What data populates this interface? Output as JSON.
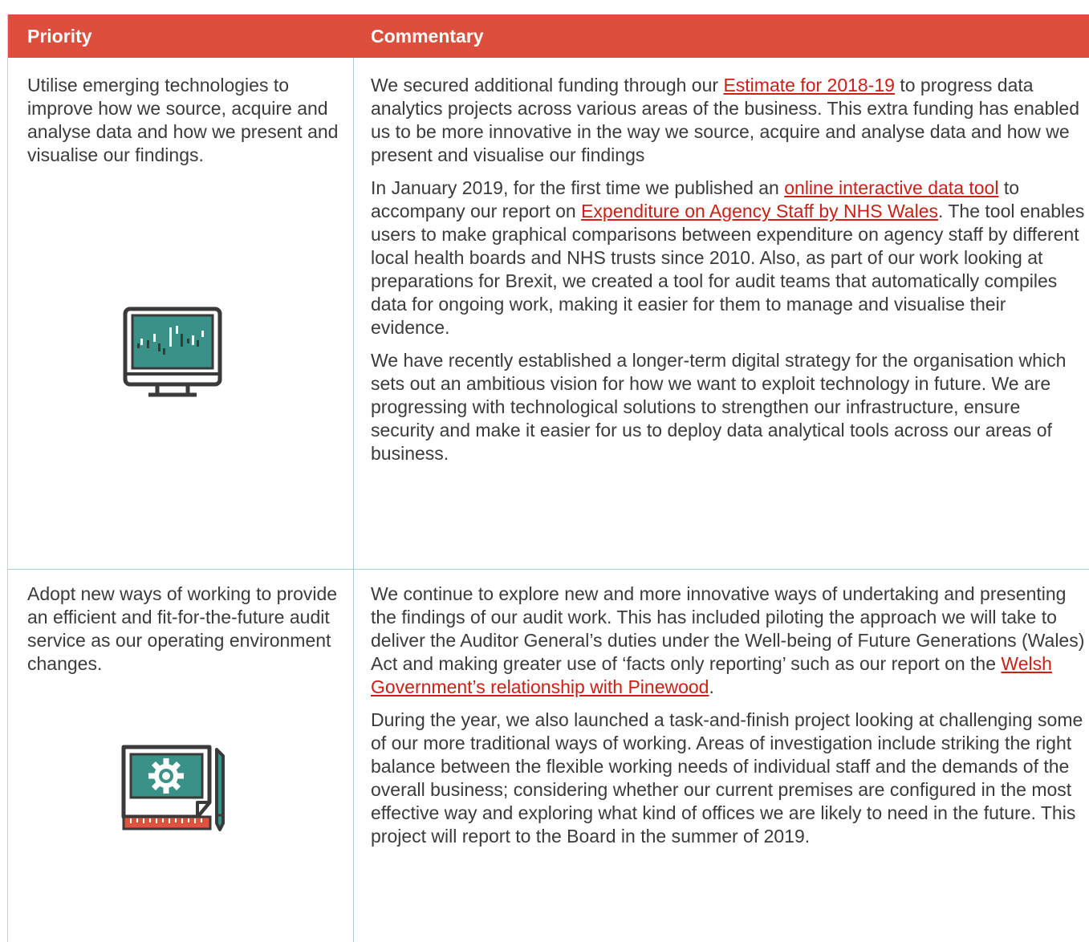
{
  "header": {
    "priority": "Priority",
    "commentary": "Commentary"
  },
  "rows": [
    {
      "priority": "Utilise emerging technologies to improve how we source, acquire and analyse data and how we present and visualise our findings.",
      "icon": "monitor-chart-icon",
      "p1": {
        "a": "We secured additional funding through our ",
        "link": "Estimate for 2018-19",
        "b": " to progress data analytics projects across various areas of the business. This extra funding has enabled us to be more innovative in the way we source, acquire and analyse data and how we present and visualise our findings"
      },
      "p2": {
        "a": "In January 2019, for the first time we published an ",
        "link1": "online interactive data tool",
        "b": " to accompany our report on ",
        "link2": "Expenditure on Agency Staff by NHS Wales",
        "c": ". The tool enables users to make graphical comparisons between expenditure on agency staff by different local health boards and NHS trusts since 2010. Also, as part of our work looking at preparations for Brexit, we created a tool for audit teams that automatically compiles data for ongoing work, making it easier for them to manage and visualise their evidence."
      },
      "p3": "We have recently established a longer-term digital strategy for the organisation which sets out an ambitious vision for how we want to exploit technology in future. We are progressing with technological solutions to strengthen our infrastructure, ensure security and make it easier for us to deploy data analytical tools across our areas of business."
    },
    {
      "priority": "Adopt new ways of working to provide an efficient and fit-for-the-future audit service as our operating environment changes.",
      "icon": "design-gear-pencil-icon",
      "p1": {
        "a": "We continue to explore new and more innovative ways of undertaking and presenting the findings of our audit work. This has included piloting the approach we will take to deliver the Auditor General’s duties under the Well-being of Future Generations (Wales) Act and making greater use of ‘facts only reporting’ such as our report on the ",
        "link": "Welsh Government’s relationship with Pinewood",
        "b": "."
      },
      "p2": "During the year, we also launched a task-and-finish project looking at challenging some of our more traditional ways of working.  Areas of investigation include striking the right balance between the flexible working needs of individual staff and the demands of the overall business; considering whether our current premises are configured in the most effective way and exploring what kind of offices we are likely to need in the future. This project will report to the Board in the summer of 2019."
    }
  ],
  "colors": {
    "header": "#dd4f3c",
    "link": "#cc1f16",
    "teal": "#3a9187",
    "dark": "#3a3a3a",
    "divider": "#a9c9dc"
  }
}
